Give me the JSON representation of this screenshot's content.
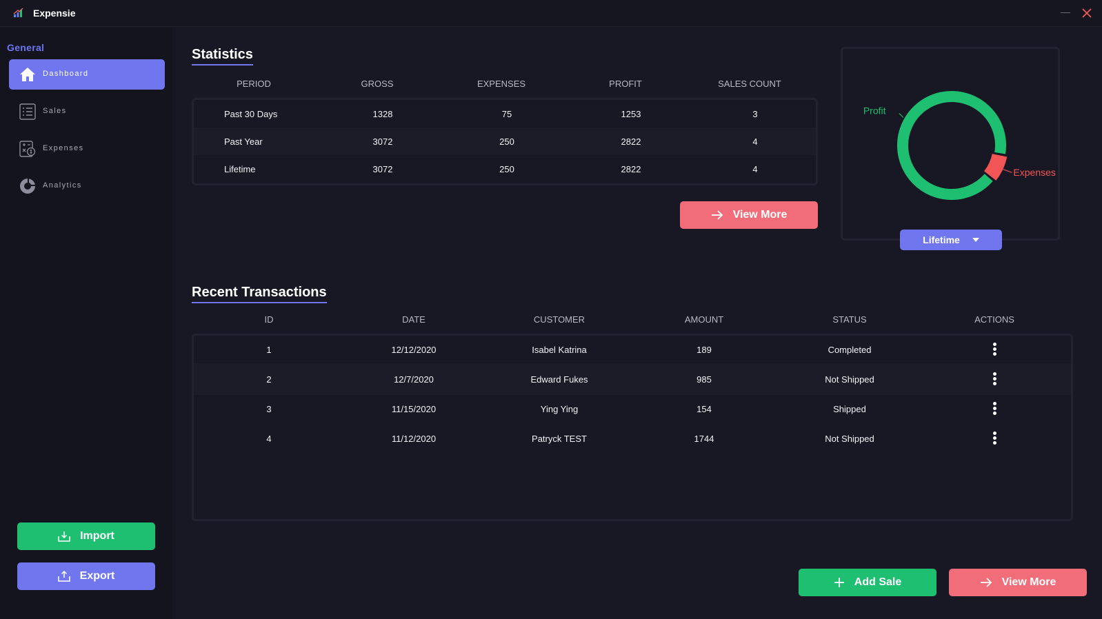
{
  "app": {
    "title": "Expensie"
  },
  "sidebar": {
    "section": "General",
    "items": [
      {
        "label": "Dashboard",
        "icon": "home-icon",
        "active": true
      },
      {
        "label": "Sales",
        "icon": "list-icon",
        "active": false
      },
      {
        "label": "Expenses",
        "icon": "calculator-dollar-icon",
        "active": false
      },
      {
        "label": "Analytics",
        "icon": "donut-chart-icon",
        "active": false
      }
    ],
    "import_label": "Import",
    "export_label": "Export"
  },
  "statistics": {
    "title": "Statistics",
    "headers": [
      "PERIOD",
      "GROSS",
      "EXPENSES",
      "PROFIT",
      "SALES COUNT"
    ],
    "rows": [
      [
        "Past 30 Days",
        "1328",
        "75",
        "1253",
        "3"
      ],
      [
        "Past Year",
        "3072",
        "250",
        "2822",
        "4"
      ],
      [
        "Lifetime",
        "3072",
        "250",
        "2822",
        "4"
      ]
    ],
    "view_more_label": "View More"
  },
  "chart_data": {
    "type": "pie",
    "style": "donut",
    "categories": [
      "Profit",
      "Expenses"
    ],
    "values": [
      2822,
      250
    ],
    "colors": [
      "#1fbf72",
      "#f25555"
    ],
    "period": "Lifetime",
    "labels_placement": "outside"
  },
  "chart_filter": {
    "selected": "Lifetime"
  },
  "transactions": {
    "title": "Recent Transactions",
    "headers": [
      "ID",
      "DATE",
      "CUSTOMER",
      "AMOUNT",
      "STATUS",
      "ACTIONS"
    ],
    "rows": [
      [
        "1",
        "12/12/2020",
        "Isabel Katrina",
        "189",
        "Completed"
      ],
      [
        "2",
        "12/7/2020",
        "Edward Fukes",
        "985",
        "Not Shipped"
      ],
      [
        "3",
        "11/15/2020",
        "Ying Ying",
        "154",
        "Shipped"
      ],
      [
        "4",
        "11/12/2020",
        "Patryck TEST",
        "1744",
        "Not Shipped"
      ]
    ],
    "add_sale_label": "Add Sale",
    "view_more_label": "View More"
  },
  "colors": {
    "accent": "#6f76ee",
    "green": "#1fbf72",
    "red": "#f16d79",
    "background": "#181824"
  }
}
